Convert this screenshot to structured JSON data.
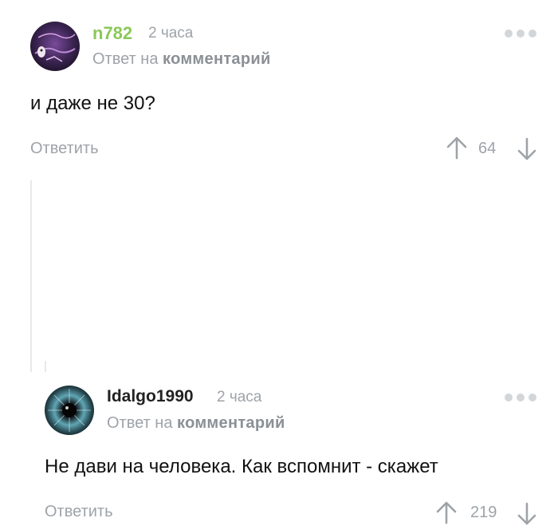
{
  "comments": [
    {
      "author": "n782",
      "time": "2 часа",
      "reply_prefix": "Ответ на",
      "reply_link": "комментарий",
      "text": "и даже не 30?",
      "reply_label": "Ответить",
      "rating": "64",
      "author_color": "#8ac858"
    },
    {
      "author": "Idalgo1990",
      "time": "2 часа",
      "reply_prefix": "Ответ на",
      "reply_link": "комментарий",
      "text": "Не дави на человека. Как вспомнит - скажет",
      "reply_label": "Ответить",
      "rating": "219",
      "author_color": "#222222"
    }
  ],
  "icons": {
    "menu": "more-dots-icon",
    "upvote": "arrow-up-icon",
    "downvote": "arrow-down-icon"
  }
}
